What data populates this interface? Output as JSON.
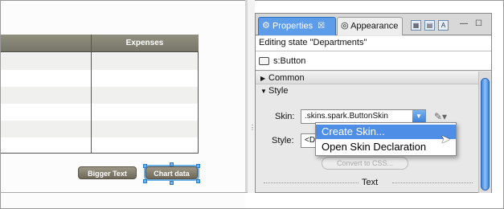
{
  "table": {
    "column_header": "Expenses"
  },
  "canvas_buttons": {
    "bigger_text": "Bigger Text",
    "chart_data": "Chart data"
  },
  "panel": {
    "tabs": [
      {
        "label": "Properties",
        "icon": "properties-icon"
      },
      {
        "label": "Appearance",
        "icon": "appearance-icon"
      }
    ],
    "close_glyph": "☒",
    "editing_state": "Editing state \"Departments\"",
    "component": "s:Button",
    "sections": {
      "common": "Common",
      "style": "Style"
    },
    "skin": {
      "label": "Skin:",
      "value": ".skins.spark.ButtonSkin"
    },
    "style": {
      "label": "Style:",
      "value": "<D"
    },
    "convert_button": "Convert to CSS...",
    "text_section": "Text"
  },
  "dropdown_menu": {
    "items": [
      "Create Skin...",
      "Open Skin Declaration"
    ],
    "highlighted": 0
  },
  "colors": {
    "accent": "#4f8ee6",
    "selection_handle": "#6cb2e8",
    "table_header": "#918f7e"
  }
}
